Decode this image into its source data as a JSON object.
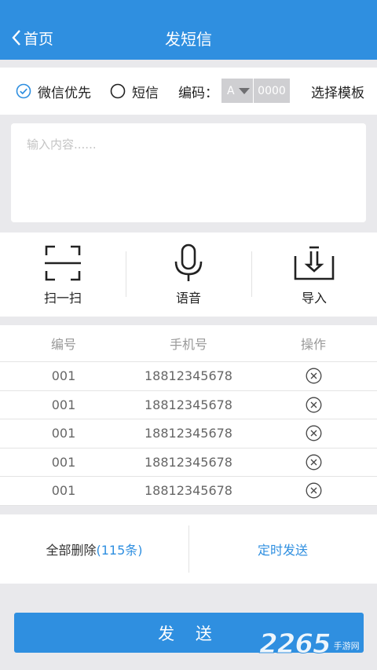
{
  "header": {
    "back_label": "首页",
    "title": "发短信"
  },
  "options": {
    "wechat_first": "微信优先",
    "sms": "短信",
    "encoding_label": "编码：",
    "encoding_value": "A",
    "encoding_code": "0000",
    "template_button": "选择模板"
  },
  "content": {
    "placeholder": "输入内容......"
  },
  "tools": [
    {
      "label": "扫一扫",
      "icon": "scan-icon"
    },
    {
      "label": "语音",
      "icon": "microphone-icon"
    },
    {
      "label": "导入",
      "icon": "import-icon"
    }
  ],
  "table": {
    "headers": [
      "编号",
      "手机号",
      "操作"
    ],
    "rows": [
      {
        "id": "001",
        "phone": "18812345678"
      },
      {
        "id": "001",
        "phone": "18812345678"
      },
      {
        "id": "001",
        "phone": "18812345678"
      },
      {
        "id": "001",
        "phone": "18812345678"
      },
      {
        "id": "001",
        "phone": "18812345678"
      }
    ]
  },
  "actions": {
    "delete_all": "全部删除",
    "count": "(115条)",
    "scheduled": "定时发送"
  },
  "send_button": "发 送",
  "watermark": {
    "number": "2265",
    "text": "手游网"
  },
  "colors": {
    "accent": "#2f8fe0",
    "background": "#e9e9ec"
  }
}
